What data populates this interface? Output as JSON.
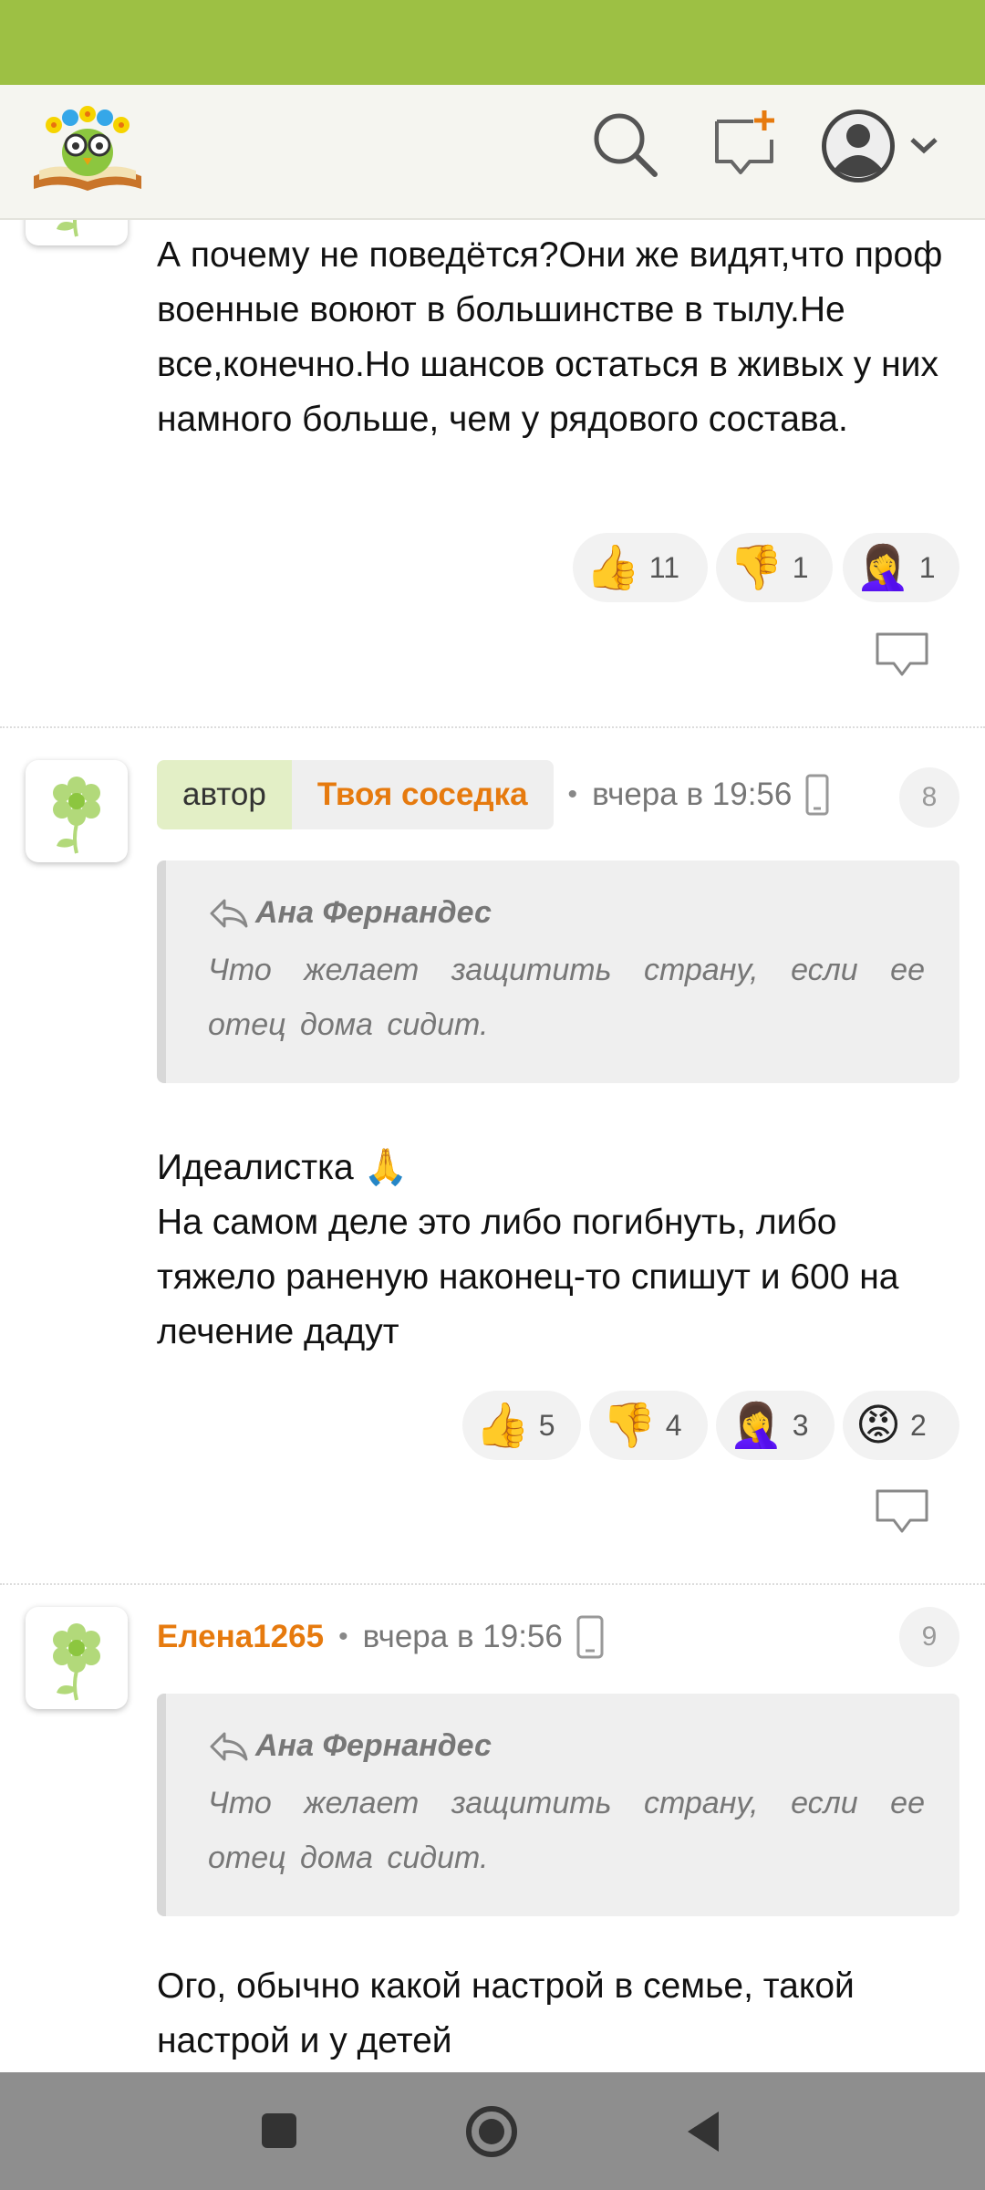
{
  "header": {
    "logo_icon": "book-owl-logo",
    "search_icon": "search-icon",
    "new_message_icon": "new-message-icon",
    "profile_icon": "user-avatar-icon",
    "menu_icon": "chevron-down-icon"
  },
  "colors": {
    "status_bar": "#9dc044",
    "accent_orange": "#e67a0e",
    "author_tag_bg": "#e3efc6"
  },
  "comments": [
    {
      "text": "А почему не поведётся?Они же видят,что проф военные воюют в большинстве в тылу.Не все,конечно.Но шансов остаться в живых у них намного больше, чем у рядового состава.",
      "reactions": [
        {
          "emoji": "👍",
          "count": "11"
        },
        {
          "emoji": "👎",
          "count": "1"
        },
        {
          "emoji": "🤦‍♀️",
          "count": "1"
        }
      ]
    },
    {
      "author_tag": "автор",
      "user": "Твоя соседка",
      "time": "вчера в 19:56",
      "number": "8",
      "quote_author": "Ана Фернандес",
      "quote_text": "Что желает защитить страну, если ее отец дома сидит.",
      "text_line1": "Идеалистка 🙏",
      "text_rest": "На самом деле это либо погибнуть, либо тяжело раненую наконец-то спишут и 600 на лечение дадут",
      "reactions": [
        {
          "emoji": "👍",
          "count": "5"
        },
        {
          "emoji": "👎",
          "count": "4"
        },
        {
          "emoji": "🤦‍♀️",
          "count": "3"
        },
        {
          "emoji": "😡",
          "count": "2"
        }
      ]
    },
    {
      "user": "Елена1265",
      "time": "вчера в 19:56",
      "number": "9",
      "quote_author": "Ана Фернандес",
      "quote_text": "Что желает защитить страну, если ее отец дома сидит.",
      "text": "Ого, обычно какой настрой в семье, такой настрой и у детей"
    }
  ],
  "nav": {
    "recent_icon": "square-icon",
    "home_icon": "circle-icon",
    "back_icon": "back-triangle-icon"
  }
}
